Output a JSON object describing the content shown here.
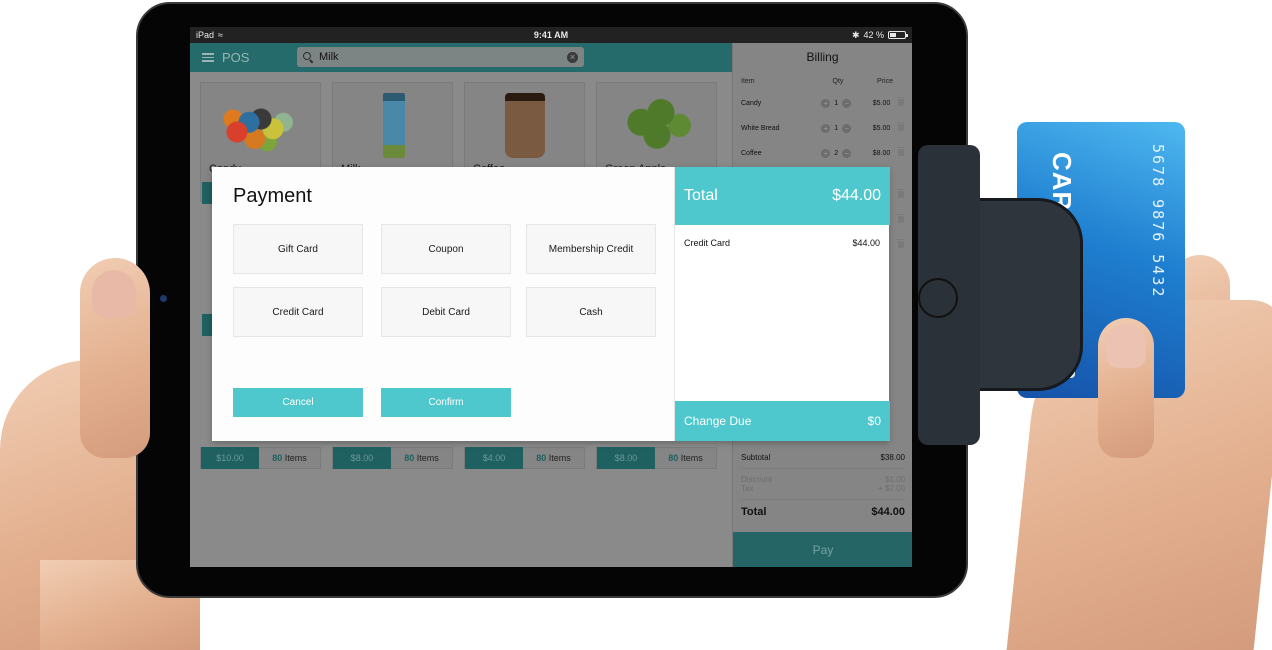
{
  "status_bar": {
    "device": "iPad",
    "time": "9:41 AM",
    "battery_text": "42 %",
    "battery_level_percent": 42
  },
  "header": {
    "app_title": "POS",
    "search": {
      "value": "Milk",
      "placeholder": ""
    }
  },
  "products": [
    {
      "name": "Candy",
      "price": "$10.00",
      "stock_count": "80",
      "stock_label": "Items",
      "image": "gummy-bears-image"
    },
    {
      "name": "Milk",
      "price": "$8.00",
      "stock_count": "80",
      "stock_label": "Items",
      "image": "milk-carton-image"
    },
    {
      "name": "Coffee",
      "price": "$4.00",
      "stock_count": "80",
      "stock_label": "Items",
      "image": "coffee-cup-image"
    },
    {
      "name": "Green Apple",
      "price": "$8.00",
      "stock_count": "80",
      "stock_label": "Items",
      "image": "green-apples-image"
    }
  ],
  "billing": {
    "title": "Billing",
    "columns": {
      "item": "Item",
      "qty": "Qty",
      "price": "Price"
    },
    "rows": [
      {
        "item": "Candy",
        "qty": "1",
        "price": "$5.00"
      },
      {
        "item": "White Bread",
        "qty": "1",
        "price": "$5.00"
      },
      {
        "item": "Coffee",
        "qty": "2",
        "price": "$8.00"
      }
    ],
    "subtotal_label": "Subtotal",
    "subtotal": "$38.00",
    "discount_label": "Discount",
    "discount": "- $1.00",
    "tax_label": "Tax",
    "tax": "+ $7.00",
    "total_label": "Total",
    "total": "$44.00",
    "pay_label": "Pay"
  },
  "payment_modal": {
    "title": "Payment",
    "methods": [
      "Gift Card",
      "Coupon",
      "Membership Credit",
      "Credit Card",
      "Debit Card",
      "Cash"
    ],
    "cancel_label": "Cancel",
    "confirm_label": "Confirm",
    "total_label": "Total",
    "total_amount": "$44.00",
    "tenders": [
      {
        "method": "Credit Card",
        "amount": "$44.00"
      }
    ],
    "change_due_label": "Change Due",
    "change_due": "$0"
  },
  "credit_card": {
    "brand_text": "CARD",
    "number": "5678 9876 5432"
  },
  "colors": {
    "accent": "#4ec8cc",
    "header_dimmed": "#256b6b",
    "price_tag_dimmed": "#1f6060"
  }
}
